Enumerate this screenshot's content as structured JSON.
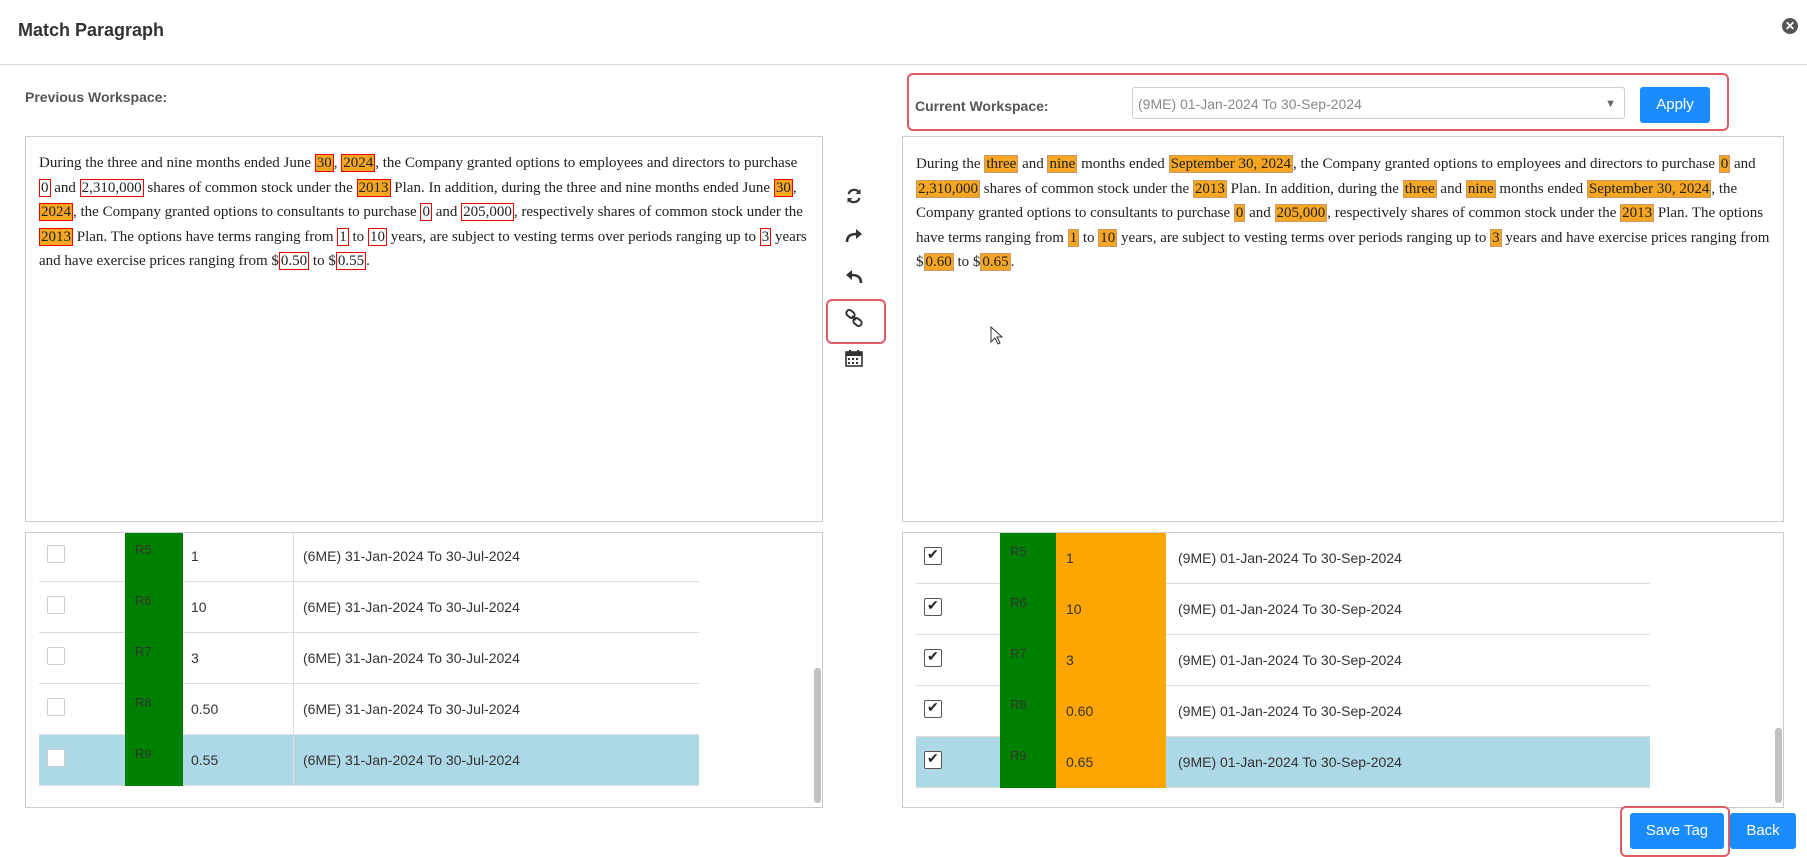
{
  "title": "Match Paragraph",
  "close_glyph": "✕",
  "previous_workspace_label": "Previous Workspace:",
  "current_workspace_label": "Current Workspace:",
  "current_workspace_selected": "(9ME) 01-Jan-2024 To 30-Sep-2024",
  "apply_label": "Apply",
  "save_tag_label": "Save Tag",
  "back_label": "Back",
  "toolbar_icons": [
    "refresh-icon",
    "redo-icon",
    "undo-icon",
    "link-icon",
    "calendar-icon"
  ],
  "left_rows": [
    {
      "tag": "R5",
      "value": "1",
      "period": "(6ME) 31-Jan-2024 To 30-Jul-2024",
      "checked": false,
      "selected": false
    },
    {
      "tag": "R6",
      "value": "10",
      "period": "(6ME) 31-Jan-2024 To 30-Jul-2024",
      "checked": false,
      "selected": false
    },
    {
      "tag": "R7",
      "value": "3",
      "period": "(6ME) 31-Jan-2024 To 30-Jul-2024",
      "checked": false,
      "selected": false
    },
    {
      "tag": "R8",
      "value": "0.50",
      "period": "(6ME) 31-Jan-2024 To 30-Jul-2024",
      "checked": false,
      "selected": false
    },
    {
      "tag": "R9",
      "value": "0.55",
      "period": "(6ME) 31-Jan-2024 To 30-Jul-2024",
      "checked": false,
      "selected": true
    }
  ],
  "right_rows": [
    {
      "tag": "R5",
      "value": "1",
      "period": "(9ME) 01-Jan-2024 To 30-Sep-2024",
      "checked": true,
      "selected": false
    },
    {
      "tag": "R6",
      "value": "10",
      "period": "(9ME) 01-Jan-2024 To 30-Sep-2024",
      "checked": true,
      "selected": false
    },
    {
      "tag": "R7",
      "value": "3",
      "period": "(9ME) 01-Jan-2024 To 30-Sep-2024",
      "checked": true,
      "selected": false
    },
    {
      "tag": "R8",
      "value": "0.60",
      "period": "(9ME) 01-Jan-2024 To 30-Sep-2024",
      "checked": true,
      "selected": false
    },
    {
      "tag": "R9",
      "value": "0.65",
      "period": "(9ME) 01-Jan-2024 To 30-Sep-2024",
      "checked": true,
      "selected": true
    }
  ],
  "colors": {
    "accent": "#1a8cff",
    "tag_green": "#008000",
    "value_orange": "#ffa500",
    "selected_row": "#add8e6",
    "highlight_red": "#e00000"
  },
  "left_paragraph": [
    {
      "t": "During the three and nine months ended June "
    },
    {
      "t": "30",
      "h": "both"
    },
    {
      "t": ", "
    },
    {
      "t": "2024",
      "h": "both"
    },
    {
      "t": ", the Company granted options to employees and directors to purchase "
    },
    {
      "t": "0",
      "h": "red"
    },
    {
      "t": " and "
    },
    {
      "t": "2,310,000",
      "h": "red"
    },
    {
      "t": " shares of common stock under the "
    },
    {
      "t": "2013",
      "h": "both"
    },
    {
      "t": " Plan. In addition, during the three and nine months ended June "
    },
    {
      "t": "30",
      "h": "both"
    },
    {
      "t": ", "
    },
    {
      "t": "2024",
      "h": "both"
    },
    {
      "t": ", the Company granted options to consultants to purchase "
    },
    {
      "t": "0",
      "h": "red"
    },
    {
      "t": " and "
    },
    {
      "t": "205,000",
      "h": "red"
    },
    {
      "t": ", respectively shares of common stock under the "
    },
    {
      "t": "2013",
      "h": "both"
    },
    {
      "t": " Plan. The options have terms ranging from "
    },
    {
      "t": "1",
      "h": "red"
    },
    {
      "t": " to "
    },
    {
      "t": "10",
      "h": "red"
    },
    {
      "t": " years, are subject to vesting terms over periods ranging up to "
    },
    {
      "t": "3",
      "h": "red"
    },
    {
      "t": " years and have exercise prices ranging from $"
    },
    {
      "t": "0.50",
      "h": "red"
    },
    {
      "t": " to $"
    },
    {
      "t": "0.55",
      "h": "red"
    },
    {
      "t": "."
    }
  ],
  "right_paragraph": [
    {
      "t": "During the "
    },
    {
      "t": "three",
      "h": "org"
    },
    {
      "t": " and "
    },
    {
      "t": "nine",
      "h": "org"
    },
    {
      "t": " months ended "
    },
    {
      "t": "September 30, 2024",
      "h": "org"
    },
    {
      "t": ", the Company granted options to employees and directors to purchase "
    },
    {
      "t": "0",
      "h": "org"
    },
    {
      "t": " and "
    },
    {
      "t": "2,310,000",
      "h": "org"
    },
    {
      "t": " shares of common stock under the "
    },
    {
      "t": "2013",
      "h": "org"
    },
    {
      "t": " Plan. In addition, during the "
    },
    {
      "t": "three",
      "h": "org"
    },
    {
      "t": " and "
    },
    {
      "t": "nine",
      "h": "org"
    },
    {
      "t": " months ended "
    },
    {
      "t": "September 30, 2024",
      "h": "org"
    },
    {
      "t": ", the Company granted options to consultants to purchase "
    },
    {
      "t": "0",
      "h": "org"
    },
    {
      "t": " and "
    },
    {
      "t": "205,000",
      "h": "org"
    },
    {
      "t": ", respectively shares of common stock under the "
    },
    {
      "t": "2013",
      "h": "org"
    },
    {
      "t": " Plan. The options have terms ranging from "
    },
    {
      "t": "1",
      "h": "org"
    },
    {
      "t": " to "
    },
    {
      "t": "10",
      "h": "org"
    },
    {
      "t": " years, are subject to vesting terms over periods ranging up to "
    },
    {
      "t": "3",
      "h": "org"
    },
    {
      "t": " years and have exercise prices ranging from $"
    },
    {
      "t": "0.60",
      "h": "org"
    },
    {
      "t": " to $"
    },
    {
      "t": "0.65",
      "h": "org"
    },
    {
      "t": "."
    }
  ]
}
